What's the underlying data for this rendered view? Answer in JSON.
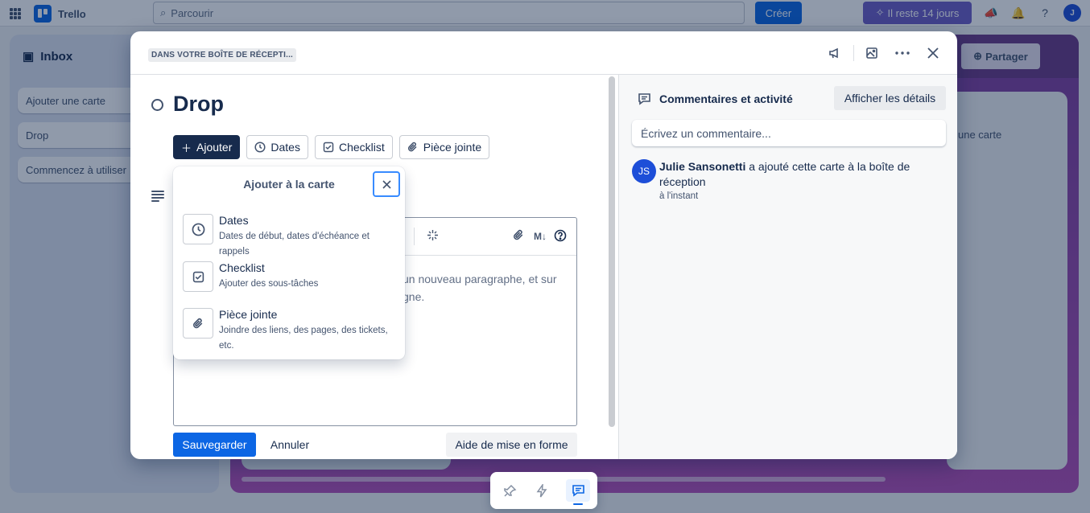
{
  "app": {
    "logo_text": "Trello",
    "search_placeholder": "Parcourir",
    "create_label": "Créer",
    "trial_label": "Il reste 14 jours",
    "avatar_initial": "J"
  },
  "inbox": {
    "title": "Inbox",
    "cards": [
      "Ajouter une carte",
      "Drop",
      "Commencez à utiliser"
    ]
  },
  "board": {
    "share_label": "Partager",
    "list_add_card": "une carte"
  },
  "modal": {
    "breadcrumb": "DANS VOTRE BOÎTE DE RÉCEPTI...",
    "card_title": "Drop",
    "actions": {
      "add": "Ajouter",
      "dates": "Dates",
      "checklist": "Checklist",
      "attachment": "Pièce jointe"
    },
    "editor_text": "un nouveau paragraphe, et sur gne.",
    "editor_text_line1": "un nouveau paragraphe, et sur",
    "editor_text_line2": "gne.",
    "markdown_label": "M↓",
    "save_label": "Sauvegarder",
    "cancel_label": "Annuler",
    "help_label": "Aide de mise en forme"
  },
  "popover": {
    "title": "Ajouter à la carte",
    "items": [
      {
        "name": "Dates",
        "desc": "Dates de début, dates d'échéance et rappels",
        "icon": "clock-icon"
      },
      {
        "name": "Checklist",
        "desc": "Ajouter des sous-tâches",
        "icon": "checkbox-icon"
      },
      {
        "name": "Pièce jointe",
        "desc": "Joindre des liens, des pages, des tickets, etc.",
        "icon": "paperclip-icon"
      }
    ]
  },
  "activity": {
    "title": "Commentaires et activité",
    "details_label": "Afficher les détails",
    "comment_placeholder": "Écrivez un commentaire...",
    "entry": {
      "avatar": "JS",
      "user": "Julie Sansonetti",
      "action": "a ajouté cette carte à la boîte de réception",
      "time": "à l'instant"
    }
  },
  "colors": {
    "primary": "#0c66e4",
    "dark_button": "#172b4d",
    "trial": "#6e5dc6",
    "board": "#b44fb6"
  }
}
